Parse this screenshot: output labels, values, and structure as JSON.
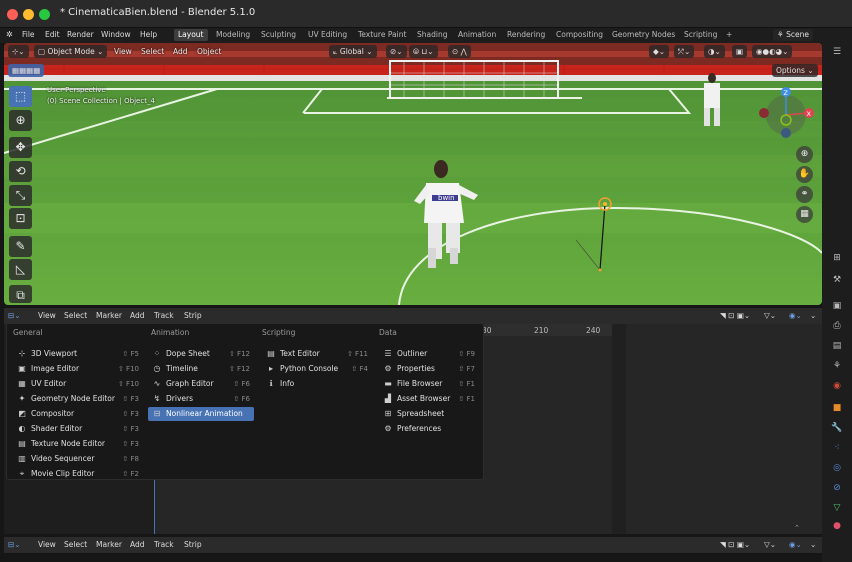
{
  "window": {
    "title": "* CinematicaBien.blend - Blender 5.1.0"
  },
  "menubar": {
    "items": [
      "File",
      "Edit",
      "Render",
      "Window",
      "Help"
    ],
    "workspaces": [
      "Layout",
      "Modeling",
      "Sculpting",
      "UV Editing",
      "Texture Paint",
      "Shading",
      "Animation",
      "Rendering",
      "Compositing",
      "Geometry Nodes",
      "Scripting"
    ],
    "active_workspace": "Layout",
    "add_tab": "+",
    "scene": "Scene"
  },
  "viewport": {
    "mode": "Object Mode",
    "menus": [
      "View",
      "Select",
      "Add",
      "Object"
    ],
    "orientation": "Global",
    "options": "Options",
    "perspective": "User Perspective",
    "collection": "(0) Scene Collection | Object_4",
    "gizmo_axes": {
      "z": "Z",
      "x": "X",
      "y": "Y"
    },
    "sponsor_text": "bwin"
  },
  "timeline": {
    "menus": [
      "View",
      "Select",
      "Marker",
      "Add",
      "Track",
      "Strip"
    ],
    "ruler": [
      "30",
      "210",
      "240"
    ]
  },
  "editor_menu": {
    "categories": [
      "General",
      "Animation",
      "Scripting",
      "Data"
    ],
    "general": [
      {
        "label": "3D Viewport",
        "shortcut": "⇧ F5",
        "icon": "viewport-3d-icon",
        "glyph": "⊹"
      },
      {
        "label": "Image Editor",
        "shortcut": "⇧ F10",
        "icon": "image-editor-icon",
        "glyph": "▣"
      },
      {
        "label": "UV Editor",
        "shortcut": "⇧ F10",
        "icon": "uv-editor-icon",
        "glyph": "▦"
      },
      {
        "label": "Geometry Node Editor",
        "shortcut": "⇧ F3",
        "icon": "geometry-nodes-icon",
        "glyph": "✦"
      },
      {
        "label": "Compositor",
        "shortcut": "⇧ F3",
        "icon": "compositor-icon",
        "glyph": "◩"
      },
      {
        "label": "Shader Editor",
        "shortcut": "⇧ F3",
        "icon": "shader-editor-icon",
        "glyph": "◐"
      },
      {
        "label": "Texture Node Editor",
        "shortcut": "⇧ F3",
        "icon": "texture-nodes-icon",
        "glyph": "▤"
      },
      {
        "label": "Video Sequencer",
        "shortcut": "⇧ F8",
        "icon": "video-sequencer-icon",
        "glyph": "▥"
      },
      {
        "label": "Movie Clip Editor",
        "shortcut": "⇧ F2",
        "icon": "movie-clip-icon",
        "glyph": "⌖"
      }
    ],
    "animation": [
      {
        "label": "Dope Sheet",
        "shortcut": "⇧ F12",
        "icon": "dope-sheet-icon",
        "glyph": "⁘"
      },
      {
        "label": "Timeline",
        "shortcut": "⇧ F12",
        "icon": "timeline-icon",
        "glyph": "◷"
      },
      {
        "label": "Graph Editor",
        "shortcut": "⇧ F6",
        "icon": "graph-editor-icon",
        "glyph": "∿"
      },
      {
        "label": "Drivers",
        "shortcut": "⇧ F6",
        "icon": "drivers-icon",
        "glyph": "↯"
      },
      {
        "label": "Nonlinear Animation",
        "shortcut": "",
        "icon": "nla-icon",
        "glyph": "⊟"
      }
    ],
    "scripting": [
      {
        "label": "Text Editor",
        "shortcut": "⇧ F11",
        "icon": "text-editor-icon",
        "glyph": "▤"
      },
      {
        "label": "Python Console",
        "shortcut": "⇧ F4",
        "icon": "python-console-icon",
        "glyph": "▸"
      },
      {
        "label": "Info",
        "shortcut": "",
        "icon": "info-icon",
        "glyph": "ℹ"
      }
    ],
    "data": [
      {
        "label": "Outliner",
        "shortcut": "⇧ F9",
        "icon": "outliner-icon",
        "glyph": "☰"
      },
      {
        "label": "Properties",
        "shortcut": "⇧ F7",
        "icon": "properties-icon",
        "glyph": "⚙"
      },
      {
        "label": "File Browser",
        "shortcut": "⇧ F1",
        "icon": "file-browser-icon",
        "glyph": "▬"
      },
      {
        "label": "Asset Browser",
        "shortcut": "⇧ F1",
        "icon": "asset-browser-icon",
        "glyph": "▟"
      },
      {
        "label": "Spreadsheet",
        "shortcut": "",
        "icon": "spreadsheet-icon",
        "glyph": "⊞"
      },
      {
        "label": "Preferences",
        "shortcut": "",
        "icon": "preferences-icon",
        "glyph": "⚙"
      }
    ],
    "highlighted": "Nonlinear Animation"
  },
  "colors": {
    "accent": "#4772b3",
    "grass": "#5aa33c",
    "stands": "#c8241c",
    "axis_x": "#e04450",
    "axis_y": "#8bc21c",
    "axis_z": "#3f8ee0"
  }
}
